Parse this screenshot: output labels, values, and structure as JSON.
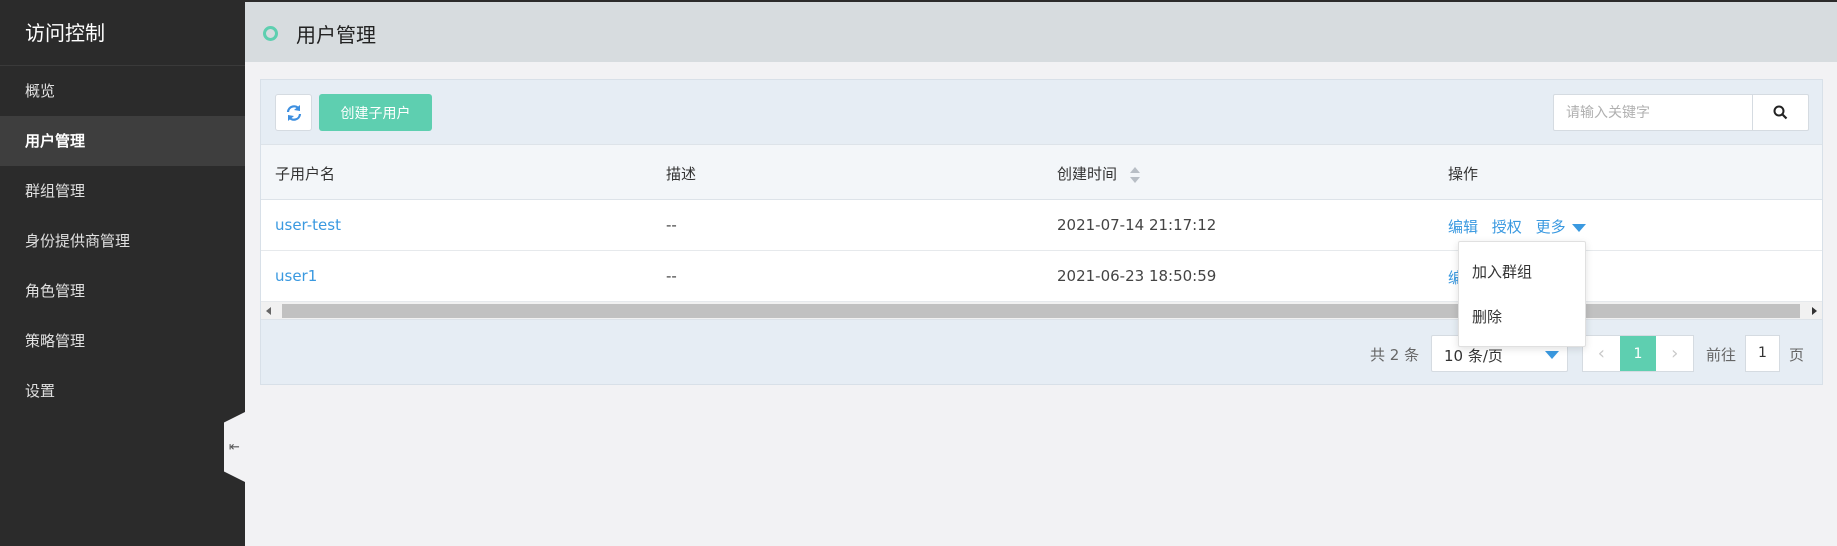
{
  "sidebar": {
    "title": "访问控制",
    "items": [
      {
        "label": "概览"
      },
      {
        "label": "用户管理"
      },
      {
        "label": "群组管理"
      },
      {
        "label": "身份提供商管理"
      },
      {
        "label": "角色管理"
      },
      {
        "label": "策略管理"
      },
      {
        "label": "设置"
      }
    ],
    "collapse_icon": "collapse-left-icon"
  },
  "header": {
    "title": "用户管理"
  },
  "toolbar": {
    "refresh_icon": "refresh-icon",
    "create_label": "创建子用户",
    "search_placeholder": "请输入关键字",
    "search_icon": "search-icon"
  },
  "table": {
    "columns": [
      "子用户名",
      "描述",
      "创建时间",
      "操作"
    ],
    "rows": [
      {
        "name": "user-test",
        "desc": "--",
        "created": "2021-07-14 21:17:12",
        "actions": [
          "编辑",
          "授权",
          "更多"
        ]
      },
      {
        "name": "user1",
        "desc": "--",
        "created": "2021-06-23 18:50:59",
        "actions": [
          "编"
        ]
      }
    ]
  },
  "dropdown": {
    "items": [
      "加入群组",
      "删除"
    ]
  },
  "pagination": {
    "total": "共 2 条",
    "page_size": "10 条/页",
    "current_page": "1",
    "goto_label": "前往",
    "goto_value": "1",
    "goto_suffix": "页"
  },
  "colors": {
    "accent": "#5ecfb0",
    "link": "#3a99e0",
    "sidebar_bg": "#2b2b2b"
  }
}
